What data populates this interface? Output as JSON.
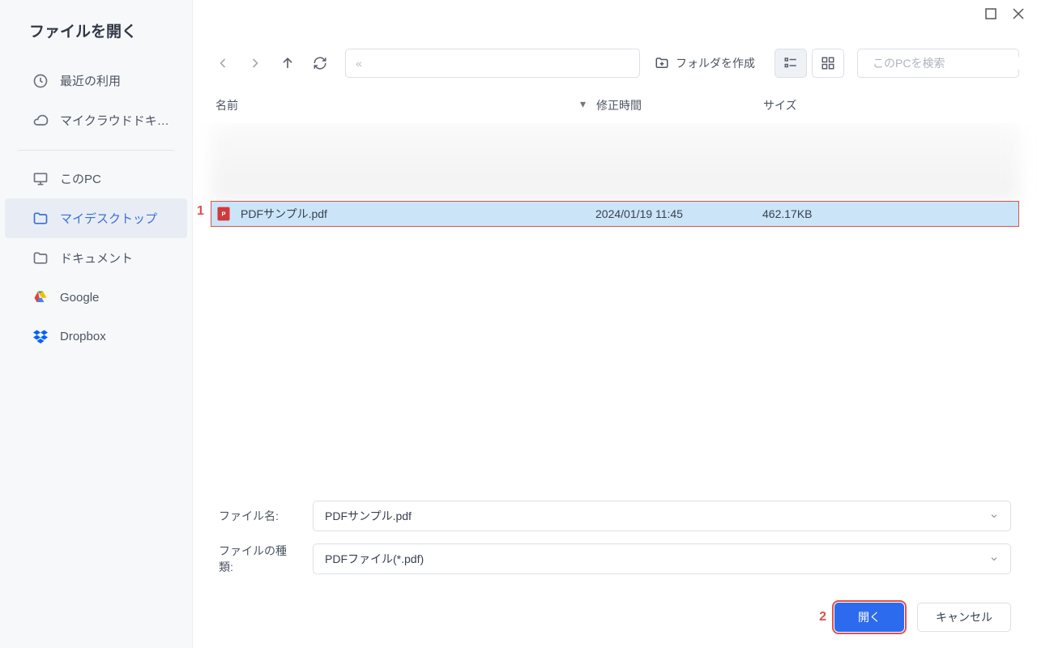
{
  "window_title": "ファイルを開く",
  "sidebar": {
    "items": [
      {
        "id": "recent",
        "label": "最近の利用"
      },
      {
        "id": "cloud",
        "label": "マイクラウドドキュ…"
      },
      {
        "id": "thispc",
        "label": "このPC"
      },
      {
        "id": "desktop",
        "label": "マイデスクトップ"
      },
      {
        "id": "documents",
        "label": "ドキュメント"
      },
      {
        "id": "google",
        "label": "Google"
      },
      {
        "id": "dropbox",
        "label": "Dropbox"
      }
    ],
    "active": "desktop"
  },
  "toolbar": {
    "create_folder_label": "フォルダを作成",
    "search_placeholder": "このPCを検索",
    "path_placeholder": "«"
  },
  "columns": {
    "name": "名前",
    "modified": "修正時間",
    "size": "サイズ"
  },
  "files": [
    {
      "name": "PDFサンプル.pdf",
      "modified": "2024/01/19 11:45",
      "size": "462.17KB",
      "selected": true
    }
  ],
  "form": {
    "filename_label": "ファイル名:",
    "filename_value": "PDFサンプル.pdf",
    "filetype_label": "ファイルの種類:",
    "filetype_value": "PDFファイル(*.pdf)"
  },
  "actions": {
    "open_label": "開く",
    "cancel_label": "キャンセル"
  },
  "callouts": {
    "one": "1",
    "two": "2"
  }
}
